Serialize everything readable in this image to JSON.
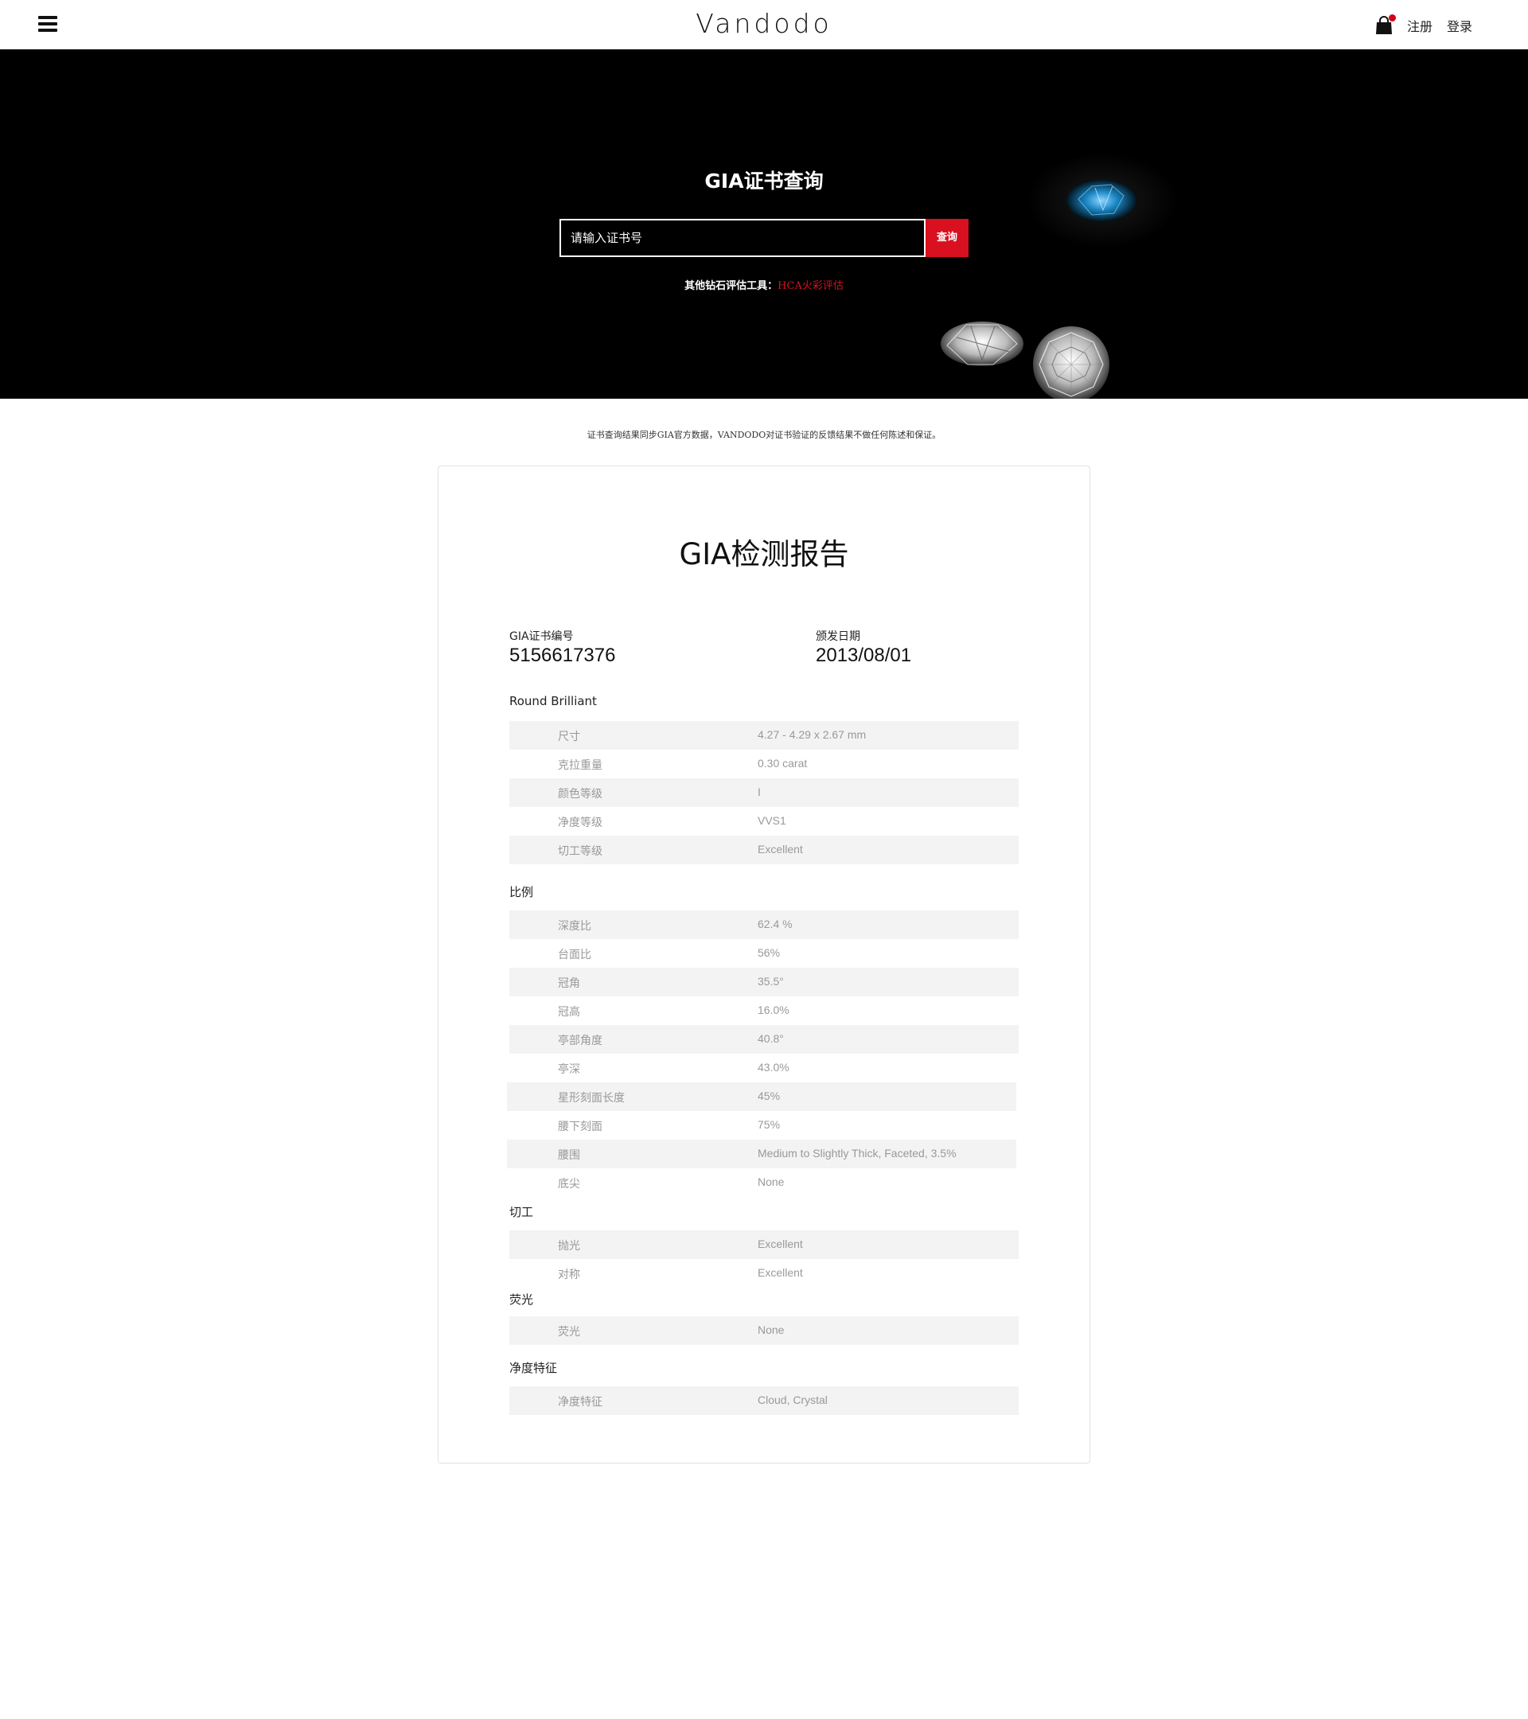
{
  "header": {
    "brand": "Vandodo",
    "register": "注册",
    "login": "登录"
  },
  "hero": {
    "title": "GIA证书查询",
    "search_placeholder": "请输入证书号",
    "search_button": "查询",
    "tools_label": "其他钻石评估工具：",
    "tools_link": "HCA火彩评估"
  },
  "notice": "证书查询结果同步GIA官方数据，VANDODO对证书验证的反馈结果不做任何陈述和保证。",
  "report": {
    "title": "GIA检测报告",
    "cert_label": "GIA证书编号",
    "cert_value": "5156617376",
    "date_label": "颁发日期",
    "date_value": "2013/08/01",
    "sections": [
      {
        "title": "Round Brilliant",
        "rows": [
          {
            "k": "尺寸",
            "v": "4.27 - 4.29 x 2.67 mm"
          },
          {
            "k": "克拉重量",
            "v": "0.30 carat"
          },
          {
            "k": "颜色等级",
            "v": "I"
          },
          {
            "k": "净度等级",
            "v": "VVS1"
          },
          {
            "k": "切工等级",
            "v": "Excellent"
          }
        ]
      },
      {
        "title": "比例",
        "rows": [
          {
            "k": "深度比",
            "v": "62.4 %"
          },
          {
            "k": "台面比",
            "v": "56%"
          },
          {
            "k": "冠角",
            "v": "35.5°"
          },
          {
            "k": "冠高",
            "v": "16.0%"
          },
          {
            "k": "亭部角度",
            "v": "40.8°"
          },
          {
            "k": "亭深",
            "v": "43.0%"
          },
          {
            "k": "星形刻面长度",
            "v": "45%"
          },
          {
            "k": "腰下刻面",
            "v": "75%"
          },
          {
            "k": "腰围",
            "v": "Medium to Slightly Thick, Faceted, 3.5%"
          },
          {
            "k": "底尖",
            "v": "None"
          }
        ]
      },
      {
        "title": "切工",
        "rows": [
          {
            "k": "抛光",
            "v": "Excellent"
          },
          {
            "k": "对称",
            "v": "Excellent"
          }
        ]
      },
      {
        "title": "荧光",
        "rows": [
          {
            "k": "荧光",
            "v": "None"
          }
        ]
      },
      {
        "title": "净度特征",
        "rows": [
          {
            "k": "净度特征",
            "v": "Cloud, Crystal"
          }
        ]
      }
    ]
  },
  "colors": {
    "accent": "#d9101f",
    "hero_bg": "#000000",
    "row_shade": "#f3f3f3"
  },
  "icons": {
    "menu": "hamburger-icon",
    "cart": "shopping-bag-icon"
  }
}
